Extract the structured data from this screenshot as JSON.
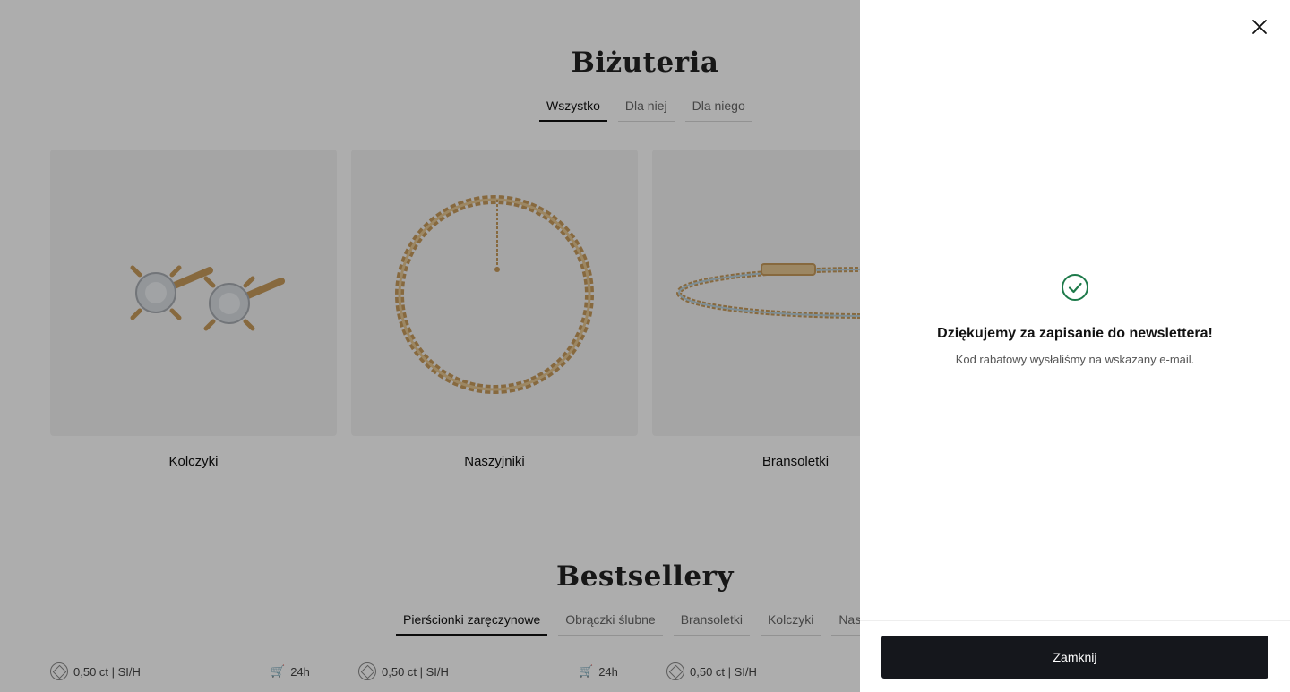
{
  "jewelry": {
    "title": "Biżuteria",
    "tabs": [
      {
        "label": "Wszystko",
        "active": true
      },
      {
        "label": "Dla niej",
        "active": false
      },
      {
        "label": "Dla niego",
        "active": false
      }
    ],
    "categories": [
      {
        "label": "Kolczyki",
        "image": "earrings"
      },
      {
        "label": "Naszyjniki",
        "image": "necklace"
      },
      {
        "label": "Bransoletki",
        "image": "bracelet"
      }
    ]
  },
  "bestsellers": {
    "title": "Bestsellery",
    "tabs": [
      {
        "label": "Pierścionki zaręczynowe",
        "active": true
      },
      {
        "label": "Obrączki ślubne",
        "active": false
      },
      {
        "label": "Bransoletki",
        "active": false
      },
      {
        "label": "Kolczyki",
        "active": false
      },
      {
        "label": "Nasz",
        "active": false
      }
    ],
    "products": [
      {
        "spec": "0,50 ct | SI/H",
        "delivery": "24h"
      },
      {
        "spec": "0,50 ct | SI/H",
        "delivery": "24h"
      },
      {
        "spec": "0,50 ct | SI/H",
        "delivery": ""
      }
    ]
  },
  "drawer": {
    "success_title": "Dziękujemy za zapisanie do newslettera!",
    "success_text": "Kod rabatowy wysłaliśmy na wskazany e-mail.",
    "close_button": "Zamknij",
    "icons": {
      "close": "close-icon",
      "success": "check-circle-icon"
    },
    "colors": {
      "success": "#1e7a4a",
      "button": "#15171c"
    }
  }
}
